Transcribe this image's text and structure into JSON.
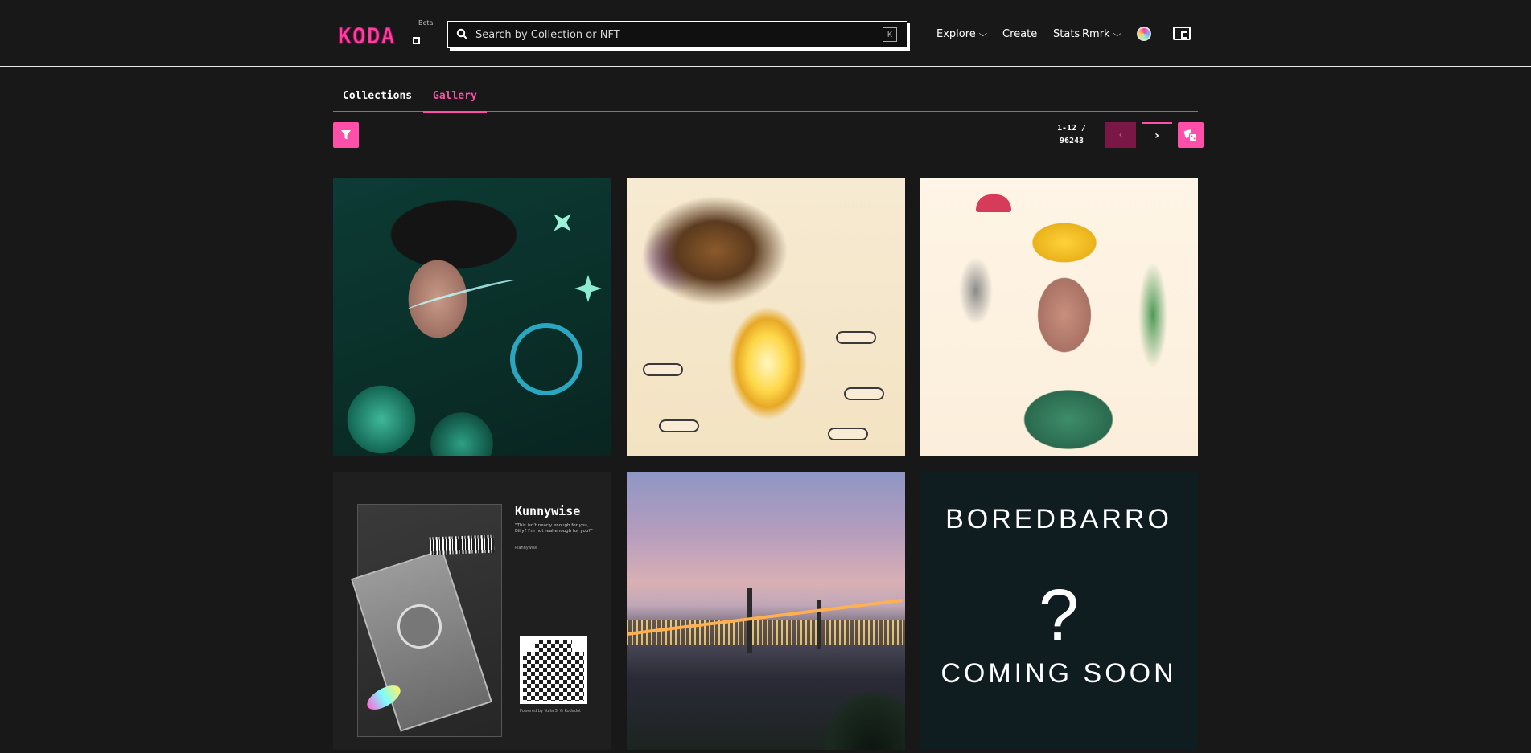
{
  "header": {
    "logo_text": "KODA",
    "logo_badge": "Beta",
    "search_placeholder": "Search by Collection or NFT",
    "search_shortcut": "K",
    "nav": [
      {
        "label": "Explore",
        "has_dropdown": true
      },
      {
        "label": "Create",
        "has_dropdown": false
      },
      {
        "label": "Stats",
        "has_dropdown": false
      },
      {
        "label": "Rmrk",
        "has_dropdown": true
      }
    ],
    "icons": [
      "search-icon",
      "globe-icon",
      "wallet-icon"
    ]
  },
  "tabs": [
    {
      "label": "Collections",
      "active": false
    },
    {
      "label": "Gallery",
      "active": true
    }
  ],
  "controls": {
    "filter_icon": "filter-icon",
    "pagination_range": "1-12 /",
    "pagination_total": "96243",
    "prev_icon": "chevron-left-icon",
    "next_icon": "chevron-right-icon",
    "random_icon": "dice-icon"
  },
  "gallery": {
    "cards": [
      {
        "name": "nft-card-1"
      },
      {
        "name": "nft-card-2"
      },
      {
        "name": "nft-card-3"
      },
      {
        "name": "nft-card-4",
        "title": "Kunnywise",
        "quote": "\"This isn't nearly enough for you, Billy? I'm not real enough for you?\"",
        "signature": "Plannywise",
        "credit": "Powered by Yulia S. & Kodadot"
      },
      {
        "name": "nft-card-5"
      },
      {
        "name": "nft-card-6",
        "line1": "BOREDBARRO",
        "line2": "?",
        "line3": "COMING SOON"
      }
    ]
  },
  "colors": {
    "accent": "#ff4fa8",
    "background": "#181818",
    "accent_dark": "#7a1747"
  }
}
